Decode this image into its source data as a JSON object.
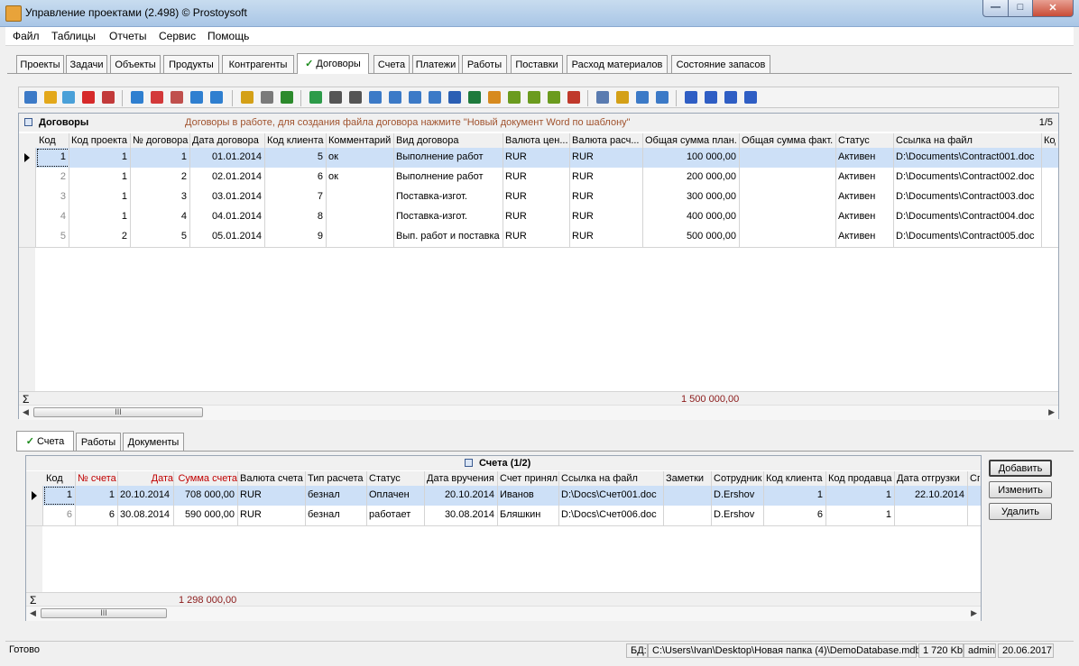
{
  "window": {
    "title": "Управление проектами (2.498) © Prostoysoft",
    "min_glyph": "—",
    "max_glyph": "□",
    "close_glyph": "✕"
  },
  "menu": [
    "Файл",
    "Таблицы",
    "Отчеты",
    "Сервис",
    "Помощь"
  ],
  "tabs_top": [
    "Проекты",
    "Задачи",
    "Объекты",
    "Продукты",
    "Контрагенты",
    "Договоры",
    "Счета",
    "Платежи",
    "Работы",
    "Поставки",
    "Расход материалов",
    "Состояние запасов"
  ],
  "tabs_top_active": "Договоры",
  "toolbar_icons": [
    "new-record-icon",
    "edit-icon",
    "copy-icon",
    "delete-icon",
    "delete-all-icon",
    "filter-icon",
    "filter-remove-icon",
    "filter-clear-icon",
    "filter-edit-icon",
    "filter-advanced-icon",
    "filter-tree-icon",
    "sort-icon",
    "sql-icon",
    "refresh-icon",
    "find-icon",
    "print-icon",
    "preview-icon",
    "export-icon",
    "export-grid-icon",
    "export-text-icon",
    "export-word-icon",
    "export-excel-icon",
    "export-html-icon",
    "export-xml-icon",
    "export-csv-icon",
    "export-pdf-icon",
    "chart-icon",
    "report-icon",
    "report-template-icon",
    "table-settings-icon",
    "columns-icon",
    "first-record-icon",
    "prev-record-icon",
    "next-record-icon",
    "last-record-icon"
  ],
  "contracts": {
    "title": "Договоры",
    "hint": "Договоры в работе, для создания файла договора нажмите \"Новый документ Word по шаблону\"",
    "count": "1/5",
    "columns": [
      "Код",
      "Код проекта",
      "№ договора",
      "Дата договора",
      "Код клиента",
      "Комментарий",
      "Вид договора",
      "Валюта цен...",
      "Валюта расч...",
      "Общая сумма план.",
      "Общая сумма факт.",
      "Статус",
      "Ссылка на файл",
      "Код"
    ],
    "rows": [
      [
        "1",
        "1",
        "1",
        "01.01.2014",
        "5",
        "ок",
        "Выполнение работ",
        "RUR",
        "RUR",
        "100 000,00",
        "",
        "Активен",
        "D:\\Documents\\Contract001.doc"
      ],
      [
        "2",
        "1",
        "2",
        "02.01.2014",
        "6",
        "ок",
        "Выполнение работ",
        "RUR",
        "RUR",
        "200 000,00",
        "",
        "Активен",
        "D:\\Documents\\Contract002.doc"
      ],
      [
        "3",
        "1",
        "3",
        "03.01.2014",
        "7",
        "",
        "Поставка-изгот.",
        "RUR",
        "RUR",
        "300 000,00",
        "",
        "Активен",
        "D:\\Documents\\Contract003.doc"
      ],
      [
        "4",
        "1",
        "4",
        "04.01.2014",
        "8",
        "",
        "Поставка-изгот.",
        "RUR",
        "RUR",
        "400 000,00",
        "",
        "Активен",
        "D:\\Documents\\Contract004.doc"
      ],
      [
        "5",
        "2",
        "5",
        "05.01.2014",
        "9",
        "",
        "Вып. работ и поставка",
        "RUR",
        "RUR",
        "500 000,00",
        "",
        "Активен",
        "D:\\Documents\\Contract005.doc"
      ]
    ],
    "sum_symbol": "Σ",
    "sum_plan": "1 500 000,00",
    "scroll_grip": "III"
  },
  "tabs_bottom": [
    "Счета",
    "Работы",
    "Документы"
  ],
  "tabs_bottom_active": "Счета",
  "invoices": {
    "title": "Счета (1/2)",
    "columns": [
      "Код",
      "№ счета",
      "Дата",
      "Сумма счета",
      "Валюта счета",
      "Тип расчета",
      "Статус",
      "Дата вручения",
      "Счет принял",
      "Ссылка на файл",
      "Заметки",
      "Сотрудник",
      "Код клиента",
      "Код продавца",
      "Дата отгрузки",
      "Сп"
    ],
    "rows": [
      [
        "1",
        "1",
        "20.10.2014",
        "708 000,00",
        "RUR",
        "безнал",
        "Оплачен",
        "20.10.2014",
        "Иванов",
        "D:\\Docs\\Счет001.doc",
        "",
        "D.Ershov",
        "1",
        "1",
        "22.10.2014"
      ],
      [
        "6",
        "6",
        "30.08.2014",
        "590 000,00",
        "RUR",
        "безнал",
        "работает",
        "30.08.2014",
        "Бляшкин",
        "D:\\Docs\\Счет006.doc",
        "",
        "D.Ershov",
        "6",
        "1",
        ""
      ]
    ],
    "sum_symbol": "Σ",
    "sum_total": "1 298 000,00",
    "scroll_grip": "III"
  },
  "buttons": {
    "add": "Добавить",
    "edit": "Изменить",
    "delete": "Удалить"
  },
  "status": {
    "ready": "Готово",
    "db_label": "БД:",
    "db_path": "C:\\Users\\Ivan\\Desktop\\Новая папка (4)\\DemoDatabase.mdb",
    "size": "1 720 Kb",
    "user": "admin",
    "date": "20.06.2017"
  },
  "colors": {
    "accent_selection": "#cde0f7",
    "sum_color": "#8b1a1a",
    "hint_color": "#a0522d",
    "check_color": "#1a8a1a"
  }
}
